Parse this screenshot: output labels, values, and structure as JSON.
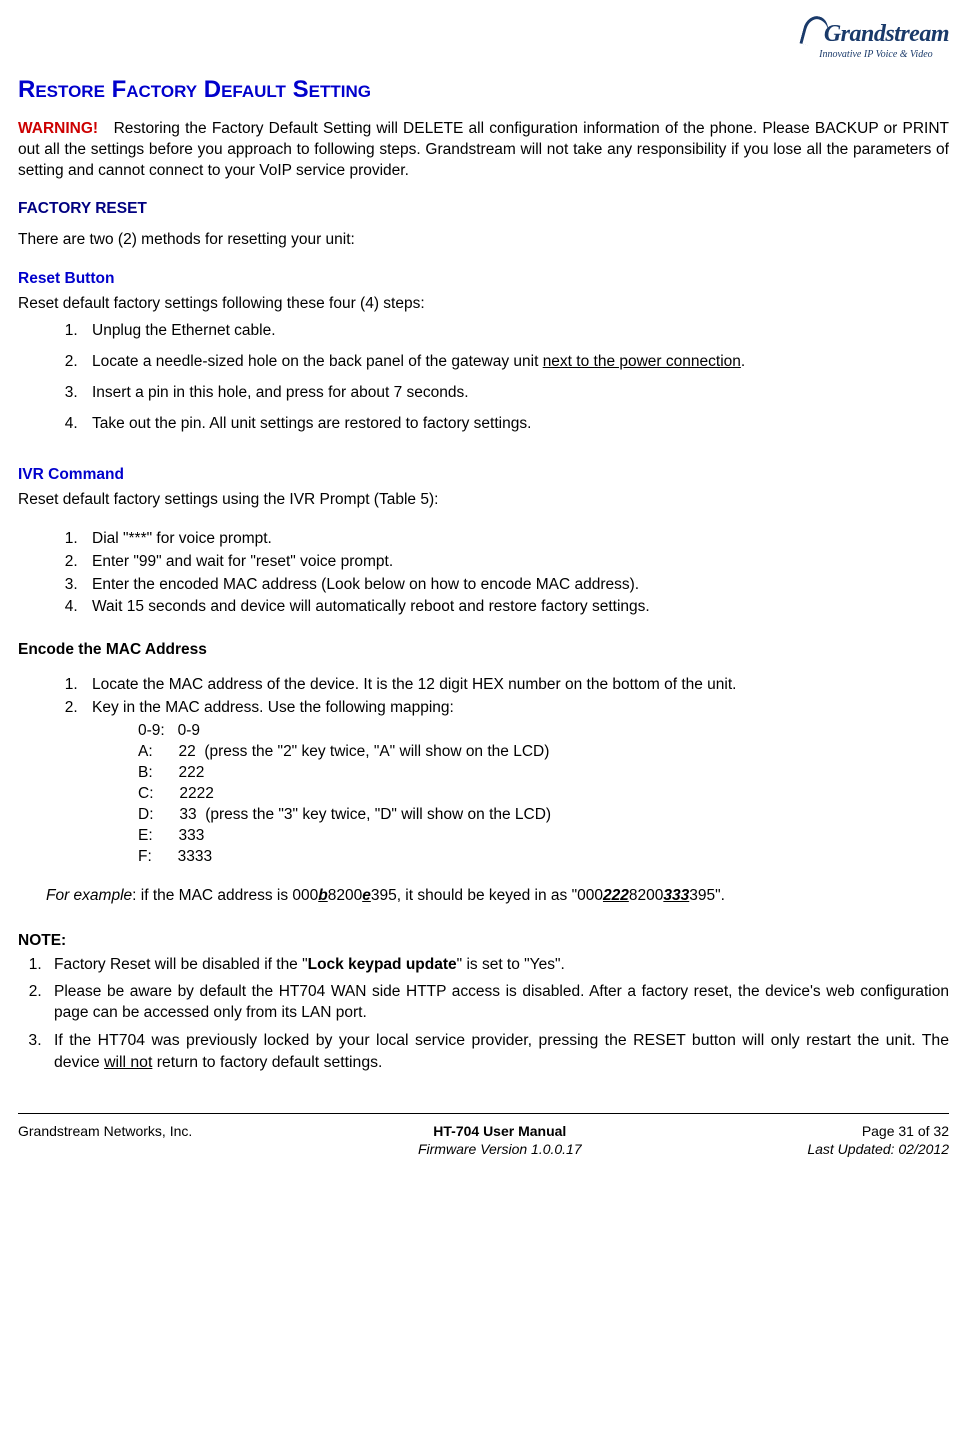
{
  "logo": {
    "name": "Grandstream",
    "tagline": "Innovative IP Voice & Video"
  },
  "title": "Restore Factory Default Setting",
  "warning": {
    "label": "WARNING!",
    "text": "Restoring the Factory Default Setting will DELETE all configuration information of the phone. Please BACKUP or PRINT out all the settings before you approach to following steps. Grandstream will not take any responsibility if you lose all the parameters of setting and cannot connect to your VoIP service provider."
  },
  "factory_reset": {
    "heading": "FACTORY RESET",
    "intro": "There are two (2) methods for resetting your unit:"
  },
  "reset_button": {
    "heading": "Reset Button",
    "intro": "Reset default factory settings following these four (4) steps:",
    "steps": [
      "Unplug the Ethernet cable.",
      "Locate a needle-sized hole on the back panel of the gateway unit ",
      "Insert a pin in this hole, and press for about 7 seconds.",
      "Take out the pin.  All unit settings are restored to factory settings."
    ],
    "step2_ul": "next to the power connection",
    "step2_suffix": "."
  },
  "ivr": {
    "heading": "IVR Command",
    "intro": "Reset default factory settings using the IVR Prompt (Table 5):",
    "steps": [
      "Dial \"***\" for voice prompt.",
      "Enter \"99\" and wait for \"reset\" voice prompt.",
      "Enter the encoded MAC address (Look below on how to encode MAC address).",
      "Wait 15 seconds and device will automatically reboot and restore factory settings."
    ]
  },
  "encode": {
    "heading": "Encode the MAC Address",
    "step1": "Locate the MAC address of the device.  It is the 12 digit HEX number on the bottom of the unit.",
    "step2": "Key in the MAC address.  Use the following mapping:",
    "mapping": [
      "0-9:   0-9",
      "A:      22  (press the \"2\" key twice, \"A\" will show on the LCD)",
      "B:      222",
      "C:      2222",
      "D:      33  (press the \"3\" key twice, \"D\" will show on the LCD)",
      "E:      333",
      "F:      3333"
    ],
    "example_label": "For example",
    "example_pre": ":  if the MAC address is 000",
    "example_b": "b",
    "example_mid1": "8200",
    "example_e": "e",
    "example_mid2": "395, it should be keyed in as \"000",
    "example_222": "222",
    "example_mid3": "8200",
    "example_333": "333",
    "example_end": "395\"."
  },
  "note": {
    "heading": "NOTE:",
    "items": {
      "n1_pre": "Factory Reset will be disabled if the \"",
      "n1_bold": "Lock keypad update",
      "n1_post": "\" is set to \"Yes\".",
      "n2": "Please be aware by default the HT704 WAN side HTTP access is disabled. After a factory reset, the device's web configuration page can be accessed only from its LAN port.",
      "n3_pre": "If the HT704 was previously locked by your local service provider, pressing the RESET button will only restart the unit.  The device ",
      "n3_ul": "will not",
      "n3_post": " return to factory default settings."
    }
  },
  "footer": {
    "left": "Grandstream Networks, Inc.",
    "center_title": "HT-704 User Manual",
    "center_sub": "Firmware Version 1.0.0.17",
    "right_page": "Page 31 of 32",
    "right_updated": "Last Updated: 02/2012"
  }
}
